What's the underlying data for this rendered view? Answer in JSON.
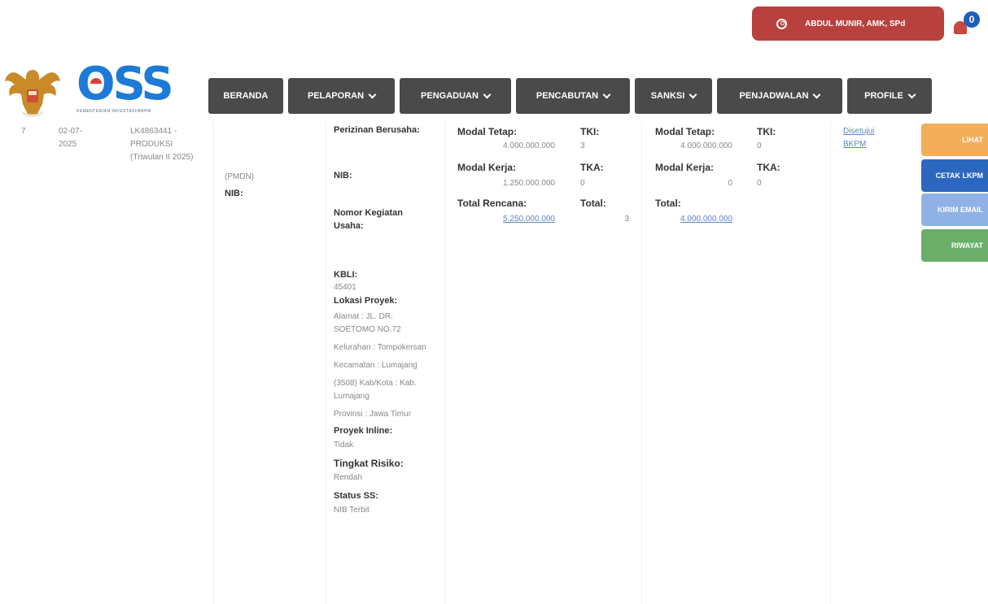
{
  "header": {
    "user_name": "ABDUL MUNIR, AMK, SPd",
    "notification_count": "0"
  },
  "logo": {
    "oss_text": "OSS",
    "caption": "KEMENTERIAN INVESTASI/BKPM"
  },
  "nav": [
    {
      "label": "BERANDA",
      "dropdown": false
    },
    {
      "label": "PELAPORAN",
      "dropdown": true
    },
    {
      "label": "PENGADUAN",
      "dropdown": true
    },
    {
      "label": "PENCABUTAN",
      "dropdown": true
    },
    {
      "label": "SANKSI",
      "dropdown": true
    },
    {
      "label": "PENJADWALAN",
      "dropdown": true
    },
    {
      "label": "PROFILE",
      "dropdown": true
    }
  ],
  "row": {
    "no": "7",
    "date": "02-07-\n2025",
    "report": "LK4863441 - PRODUKSI (Triwulan II 2025)",
    "company_type": "(PMDN)",
    "nib_label": "NIB:",
    "perizinan_label": "Perizinan Berusaha:",
    "nib2_label": "NIB:",
    "nomor_kegiatan_label": "Nomor Kegiatan Usaha:",
    "kbli_label": "KBLI:",
    "kbli_value": "45401",
    "lokasi_label": "Lokasi Proyek:",
    "alamat": "Alamat : JL. DR. SOETOMO NO.72",
    "kelurahan": "Kelurahan : Tompokersan",
    "kecamatan": "Kecamatan : Lumajang",
    "kabkota": "(3508) Kab/Kota : Kab. Lumajang",
    "provinsi": "Provinsi : Jawa Timur",
    "proyek_inline_label": "Proyek Inline:",
    "proyek_inline_value": "Tidak",
    "risiko_label": "Tingkat Risiko:",
    "risiko_value": "Rendah",
    "status_label": "Status SS:",
    "status_value": "NIB Terbit",
    "rencana": {
      "modal_tetap_label": "Modal Tetap:",
      "modal_tetap": "4.000.000.000",
      "modal_kerja_label": "Modal Kerja:",
      "modal_kerja": "1.250.000.000",
      "total_label": "Total Rencana:",
      "total": "5.250.000.000",
      "tki_label": "TKI:",
      "tki": "3",
      "tka_label": "TKA:",
      "tka": "0",
      "tk_total_label": "Total:",
      "tk_total": "3"
    },
    "realisasi": {
      "modal_tetap_label": "Modal Tetap:",
      "modal_tetap": "4.000.000.000",
      "modal_kerja_label": "Modal Kerja:",
      "modal_kerja": "0",
      "total_label": "Total:",
      "total": "4.000.000.000",
      "tki_label": "TKI:",
      "tki": "0",
      "tka_label": "TKA:",
      "tka": "0"
    },
    "status_link": "Disetujui BKPM"
  },
  "actions": [
    {
      "label": "LIHAT",
      "color": "#f2ae5a"
    },
    {
      "label": "CETAK LKPM",
      "color": "#2c67bf"
    },
    {
      "label": "KIRIM EMAIL",
      "color": "#8fb1e6"
    },
    {
      "label": "RIWAYAT",
      "color": "#6aae6a"
    }
  ]
}
